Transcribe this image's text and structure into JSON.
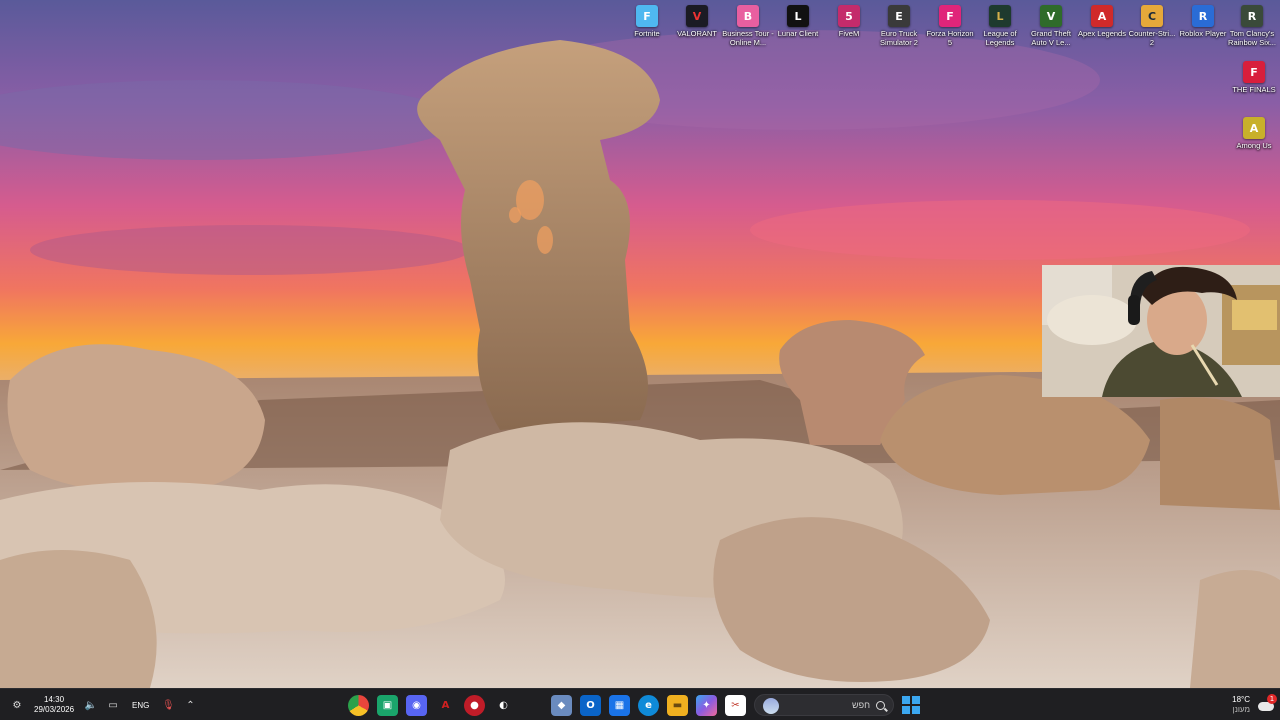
{
  "desktop": {
    "top_row": [
      {
        "label": "Fortnite",
        "glyph": "F",
        "color": "#4fb8f0",
        "icon": "fortnite-icon"
      },
      {
        "label": "VALORANT",
        "glyph": "V",
        "color": "#1b1b24",
        "icon": "valorant-icon"
      },
      {
        "label": "Business Tour - Online M...",
        "glyph": "B",
        "color": "#e85fa0",
        "icon": "business-tour-icon"
      },
      {
        "label": "Lunar Client",
        "glyph": "L",
        "color": "#111111",
        "icon": "lunar-client-icon"
      },
      {
        "label": "FiveM",
        "glyph": "5",
        "color": "#c42b6b",
        "icon": "fivem-icon"
      },
      {
        "label": "Euro Truck Simulator 2",
        "glyph": "E",
        "color": "#3a3a3a",
        "icon": "euro-truck-icon"
      },
      {
        "label": "Forza Horizon 5",
        "glyph": "F",
        "color": "#e0257a",
        "icon": "forza-icon"
      },
      {
        "label": "League of Legends",
        "glyph": "L",
        "color": "#1e3a2e",
        "icon": "league-icon"
      },
      {
        "label": "Grand Theft Auto V Le...",
        "glyph": "V",
        "color": "#2f6b2a",
        "icon": "gta-icon"
      },
      {
        "label": "Apex Legends",
        "glyph": "A",
        "color": "#d02a2a",
        "icon": "apex-icon"
      },
      {
        "label": "Counter-Stri... 2",
        "glyph": "C",
        "color": "#e6a83a",
        "icon": "counter-strike-icon"
      },
      {
        "label": "Roblox Player",
        "glyph": "R",
        "color": "#2a6cd6",
        "icon": "roblox-icon"
      },
      {
        "label": "Tom Clancy's Rainbow Six...",
        "glyph": "R",
        "color": "#3a4a3a",
        "icon": "rainbow-six-icon"
      }
    ],
    "right_column": [
      {
        "label": "THE FINALS",
        "glyph": "F",
        "color": "#d81e3c",
        "icon": "the-finals-icon"
      },
      {
        "label": "Among Us",
        "glyph": "A",
        "color": "#c8b02a",
        "icon": "among-us-icon"
      }
    ]
  },
  "taskbar": {
    "time": "14:30",
    "date": "29/03/2026",
    "language": "ENG",
    "search_placeholder": "חפש",
    "apps": [
      {
        "name": "chrome-icon",
        "glyph": "●",
        "color": "#e8453c"
      },
      {
        "name": "app-green-icon",
        "glyph": "▣",
        "color": "#1aa56b"
      },
      {
        "name": "discord-icon",
        "glyph": "◉",
        "color": "#5865f2"
      },
      {
        "name": "aesthetic-app-icon",
        "glyph": "A",
        "color": "#b01e1e"
      },
      {
        "name": "red-app-icon",
        "glyph": "●",
        "color": "#c01c28"
      },
      {
        "name": "steam-icon",
        "glyph": "◐",
        "color": "#1b2838"
      },
      {
        "name": "blank-app-icon",
        "glyph": "",
        "color": "#2a2a2e"
      },
      {
        "name": "package-icon",
        "glyph": "◆",
        "color": "#6a8bbf"
      },
      {
        "name": "outlook-icon",
        "glyph": "O",
        "color": "#0a64c8"
      },
      {
        "name": "store-icon",
        "glyph": "▦",
        "color": "#1a73e8"
      },
      {
        "name": "edge-icon",
        "glyph": "e",
        "color": "#0f8ad8"
      },
      {
        "name": "file-explorer-icon",
        "glyph": "▬",
        "color": "#f0b020"
      },
      {
        "name": "copilot-icon",
        "glyph": "✦",
        "color": "#8a5ce0"
      },
      {
        "name": "snip-icon",
        "glyph": "✂",
        "color": "#c0392b"
      }
    ],
    "weather_temp": "18°C",
    "weather_label": "מעונן",
    "notification_count": "1"
  }
}
